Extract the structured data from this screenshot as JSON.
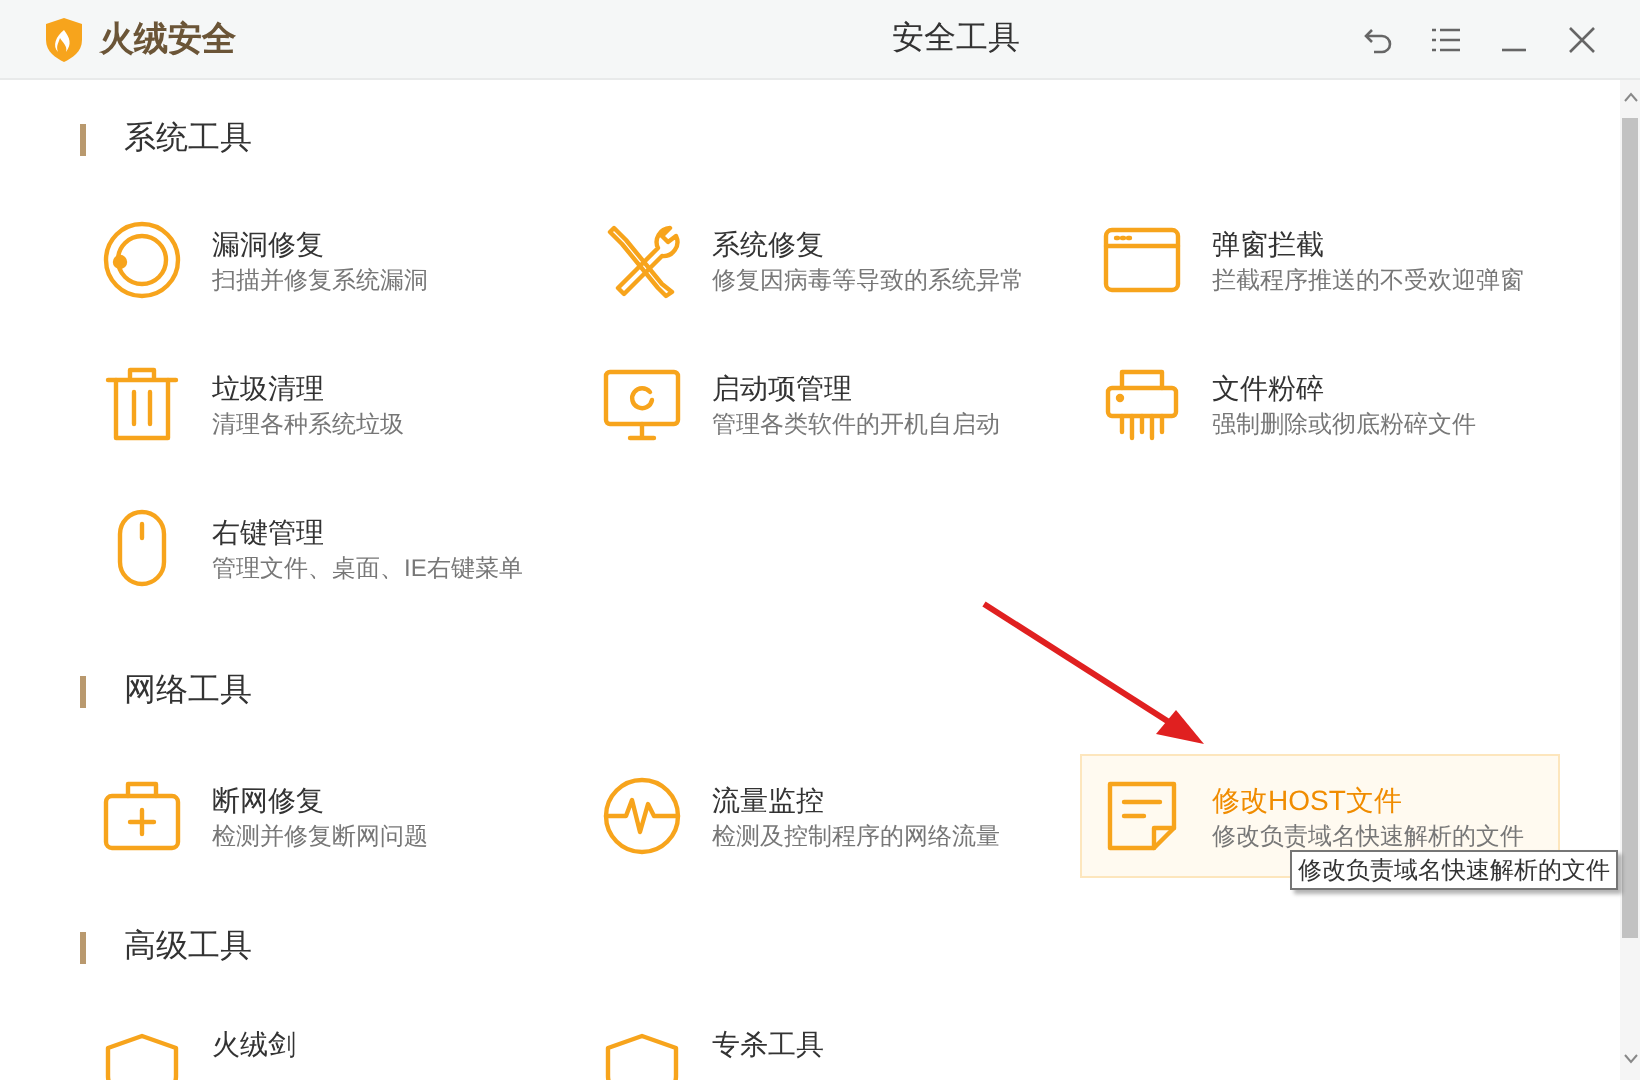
{
  "window": {
    "app_name": "火绒安全",
    "title": "安全工具"
  },
  "sections": [
    {
      "title": "系统工具",
      "items": [
        {
          "kind": "ring",
          "title": "漏洞修复",
          "description": "扫描并修复系统漏洞",
          "highlighted": false
        },
        {
          "kind": "tools",
          "title": "系统修复",
          "description": "修复因病毒等导致的系统异常",
          "highlighted": false
        },
        {
          "kind": "window",
          "title": "弹窗拦截",
          "description": "拦截程序推送的不受欢迎弹窗",
          "highlighted": false
        },
        {
          "kind": "trash",
          "title": "垃圾清理",
          "description": "清理各种系统垃圾",
          "highlighted": false
        },
        {
          "kind": "monitor",
          "title": "启动项管理",
          "description": "管理各类软件的开机自启动",
          "highlighted": false
        },
        {
          "kind": "shredder",
          "title": "文件粉碎",
          "description": "强制删除或彻底粉碎文件",
          "highlighted": false
        },
        {
          "kind": "mouse",
          "title": "右键管理",
          "description": "管理文件、桌面、IE右键菜单",
          "highlighted": false
        }
      ]
    },
    {
      "title": "网络工具",
      "items": [
        {
          "kind": "kit",
          "title": "断网修复",
          "description": "检测并修复断网问题",
          "highlighted": false
        },
        {
          "kind": "pulse",
          "title": "流量监控",
          "description": "检测及控制程序的网络流量",
          "highlighted": false
        },
        {
          "kind": "note",
          "title": "修改HOST文件",
          "description": "修改负责域名快速解析的文件",
          "highlighted": true
        }
      ]
    },
    {
      "title": "高级工具",
      "items": [
        {
          "kind": "shield",
          "title": "火绒剑",
          "highlighted": false
        },
        {
          "kind": "shield",
          "title": "专杀工具",
          "highlighted": false
        }
      ]
    }
  ],
  "tooltip": "修改负责域名快速解析的文件"
}
